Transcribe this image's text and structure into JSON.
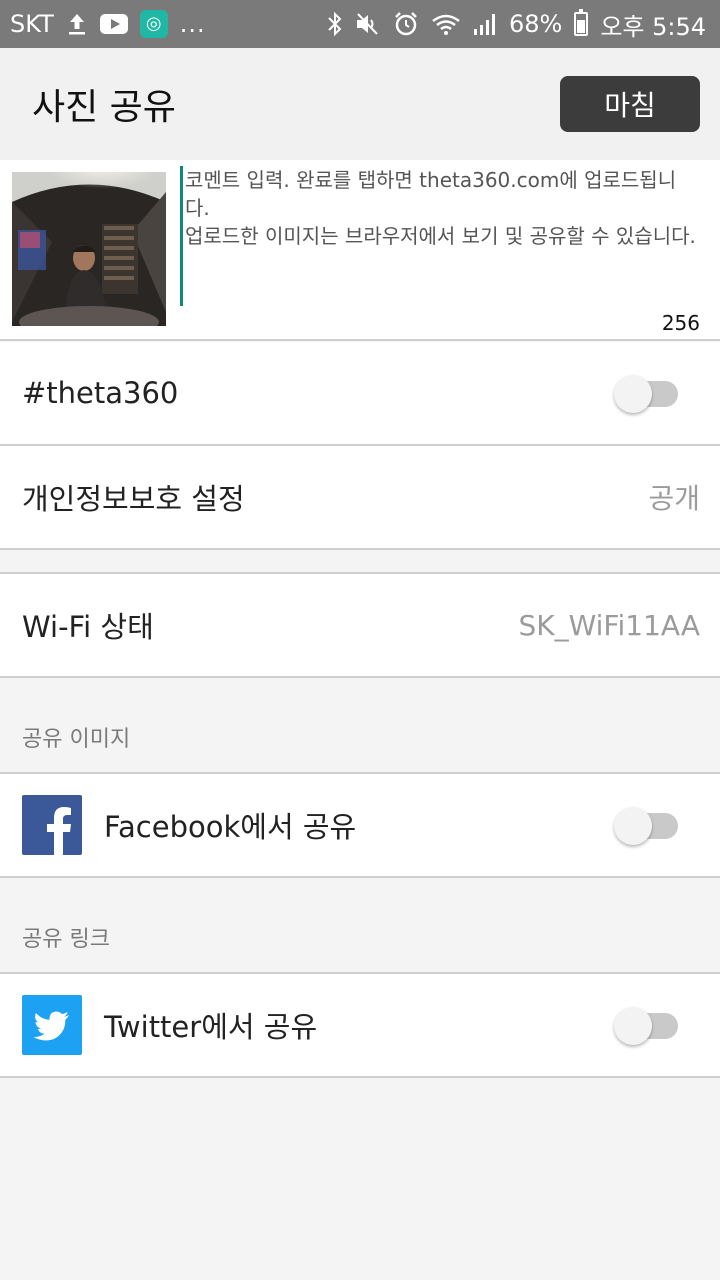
{
  "status_bar": {
    "carrier": "SKT",
    "dots": "...",
    "battery_percent": "68%",
    "time": "오후 5:54"
  },
  "appbar": {
    "title": "사진 공유",
    "done_label": "마침"
  },
  "comment": {
    "placeholder": "코멘트 입력. 완료를 탭하면 theta360.com에 업로드됩니다.\n업로드한 이미지는 브라우저에서 보기 및 공유할 수 있습니다.",
    "char_count": "256"
  },
  "settings": {
    "hashtag_label": "#theta360",
    "hashtag_enabled": false,
    "privacy_label": "개인정보보호 설정",
    "privacy_value": "공개",
    "wifi_label": "Wi-Fi 상태",
    "wifi_value": "SK_WiFi11AA"
  },
  "share_image": {
    "header": "공유 이미지",
    "facebook_label": "Facebook에서 공유",
    "facebook_enabled": false
  },
  "share_link": {
    "header": "공유 링크",
    "twitter_label": "Twitter에서 공유",
    "twitter_enabled": false
  },
  "colors": {
    "facebook": "#3b5998",
    "twitter": "#1da1f2",
    "cursor": "#0a8a78"
  }
}
